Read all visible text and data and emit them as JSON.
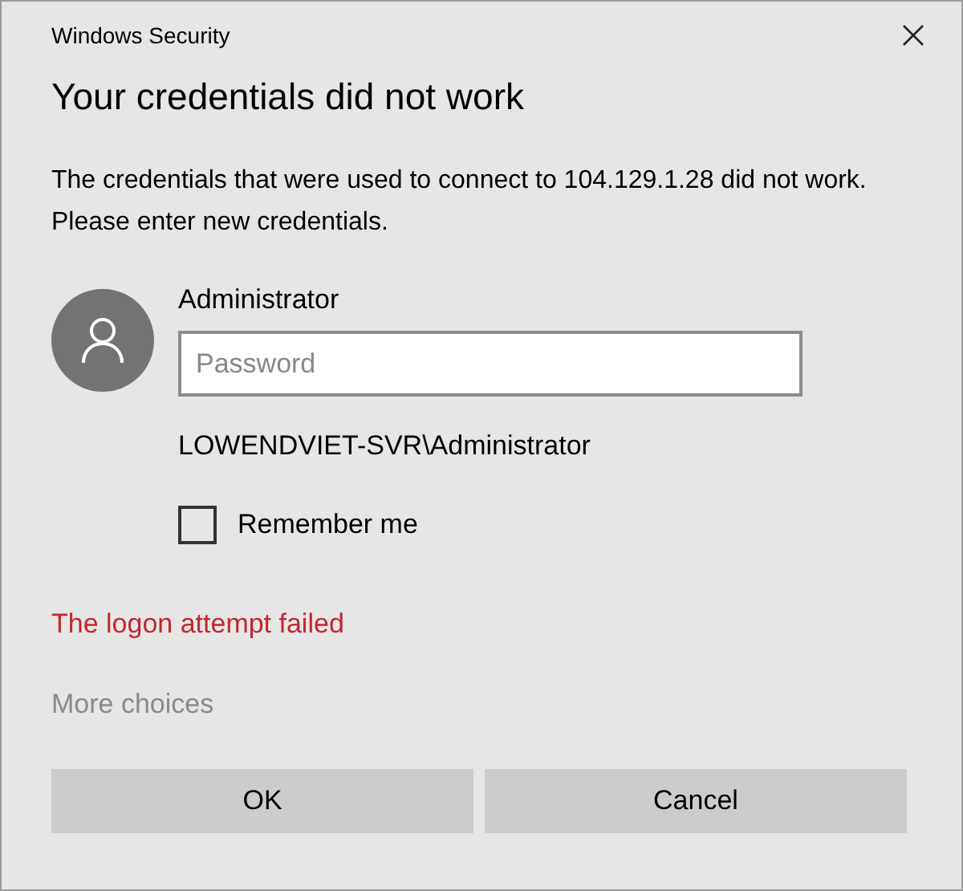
{
  "window": {
    "title": "Windows Security"
  },
  "heading": "Your credentials did not work",
  "message": "The credentials that were used to connect to 104.129.1.28 did not work. Please enter new credentials.",
  "account": {
    "name": "Administrator",
    "password": {
      "placeholder": "Password"
    },
    "domain_user": "LOWENDVIET-SVR\\Administrator"
  },
  "remember": {
    "label": "Remember me",
    "checked": false
  },
  "error": "The logon attempt failed",
  "more_choices": "More choices",
  "buttons": [
    "OK",
    "Cancel"
  ]
}
